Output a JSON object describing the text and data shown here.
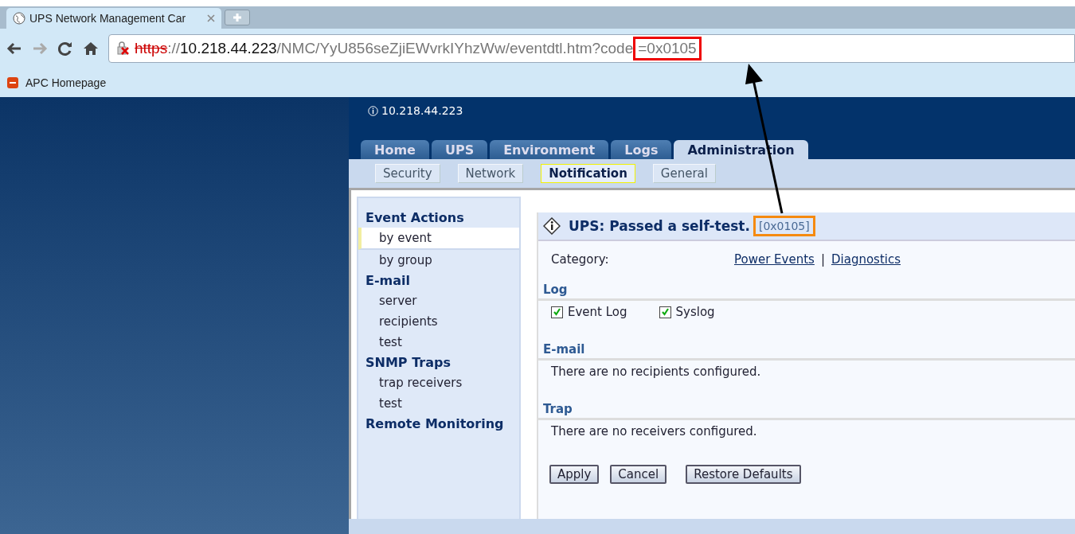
{
  "browser": {
    "tab_title": "UPS Network Management Car",
    "url": {
      "scheme": "https",
      "sep": "://",
      "host": "10.218.44.223",
      "path": "/NMC/YyU856seZjiEWvrkIYhzWw/eventdtl.htm?code",
      "highlight": "=0x0105"
    },
    "bookmarks": [
      {
        "label": "APC Homepage"
      }
    ]
  },
  "header": {
    "address": "10.218.44.223"
  },
  "tabs": [
    {
      "label": "Home",
      "selected": false
    },
    {
      "label": "UPS",
      "selected": false
    },
    {
      "label": "Environment",
      "selected": false
    },
    {
      "label": "Logs",
      "selected": false
    },
    {
      "label": "Administration",
      "selected": true
    }
  ],
  "subtabs": [
    {
      "label": "Security",
      "selected": false
    },
    {
      "label": "Network",
      "selected": false
    },
    {
      "label": "Notification",
      "selected": true
    },
    {
      "label": "General",
      "selected": false
    }
  ],
  "sidebar": {
    "items": [
      {
        "kind": "heading",
        "label": "Event Actions",
        "selected": false
      },
      {
        "kind": "link",
        "label": "by event",
        "selected": true
      },
      {
        "kind": "link",
        "label": "by group",
        "selected": false
      },
      {
        "kind": "heading",
        "label": "E-mail",
        "selected": false
      },
      {
        "kind": "link",
        "label": "server",
        "selected": false
      },
      {
        "kind": "link",
        "label": "recipients",
        "selected": false
      },
      {
        "kind": "link",
        "label": "test",
        "selected": false
      },
      {
        "kind": "heading",
        "label": "SNMP Traps",
        "selected": false
      },
      {
        "kind": "link",
        "label": "trap receivers",
        "selected": false
      },
      {
        "kind": "link",
        "label": "test",
        "selected": false
      },
      {
        "kind": "heading",
        "label": "Remote Monitoring",
        "selected": false
      }
    ]
  },
  "event": {
    "title": "UPS: Passed a self-test.",
    "code": "[0x0105]",
    "category_label": "Category:",
    "categories": [
      {
        "label": "Power Events"
      },
      {
        "label": "Diagnostics"
      }
    ],
    "separator": "|",
    "sections": [
      {
        "kind": "checks",
        "title": "Log",
        "options": [
          {
            "label": "Event Log",
            "checked": true
          },
          {
            "label": "Syslog",
            "checked": true
          }
        ]
      },
      {
        "kind": "message",
        "title": "E-mail",
        "text": "There are no recipients configured."
      },
      {
        "kind": "message",
        "title": "Trap",
        "text": "There are no receivers configured."
      }
    ],
    "buttons": [
      "Apply",
      "Cancel",
      "Restore Defaults"
    ]
  }
}
